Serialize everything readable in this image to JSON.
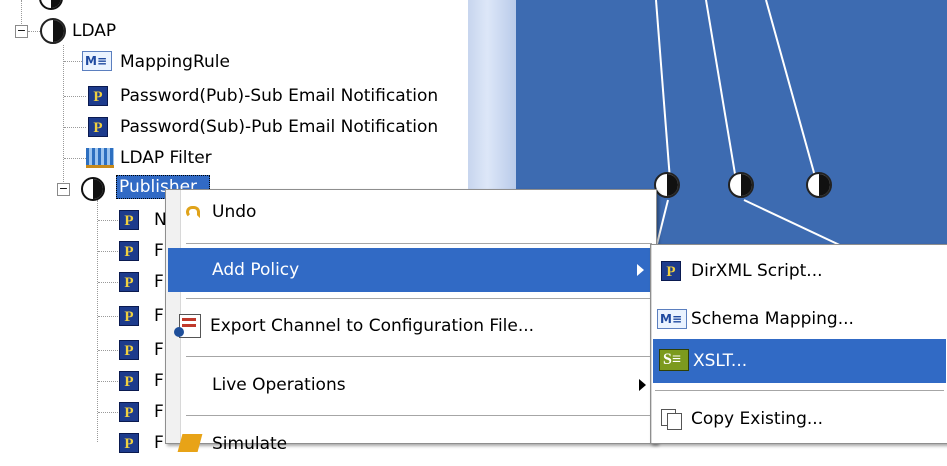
{
  "tree": {
    "ldap_label": "LDAP",
    "items": [
      {
        "label": "MappingRule",
        "icon": "mapping-rule-icon"
      },
      {
        "label": "Password(Pub)-Sub Email Notification",
        "icon": "policy-p-icon"
      },
      {
        "label": "Password(Sub)-Pub Email Notification",
        "icon": "policy-p-icon"
      },
      {
        "label": "LDAP Filter",
        "icon": "filter-icon"
      }
    ],
    "publisher_label": "Publisher",
    "publisher_children": [
      "N",
      "F",
      "F",
      "F",
      "F",
      "F",
      "F",
      "F"
    ]
  },
  "context_menu": {
    "items": [
      {
        "label": "Undo",
        "icon": "undo-icon"
      },
      {
        "label": "Add Policy",
        "icon": "",
        "submenu": true,
        "selected": true
      },
      {
        "label": "Export Channel to Configuration File...",
        "icon": "export-icon"
      },
      {
        "label": "Live Operations",
        "icon": "",
        "submenu": true
      },
      {
        "label": "Simulate",
        "icon": "simulate-icon"
      }
    ]
  },
  "submenu": {
    "items": [
      {
        "label": "DirXML Script...",
        "icon": "policy-p-icon"
      },
      {
        "label": "Schema Mapping...",
        "icon": "mapping-rule-icon"
      },
      {
        "label": "XSLT...",
        "icon": "xslt-icon",
        "selected": true
      },
      {
        "label": "Copy Existing...",
        "icon": "copy-icon"
      }
    ]
  },
  "colors": {
    "canvas": "#3d6bb1",
    "selection": "#316ac5",
    "menu_bg": "#ffffff"
  }
}
